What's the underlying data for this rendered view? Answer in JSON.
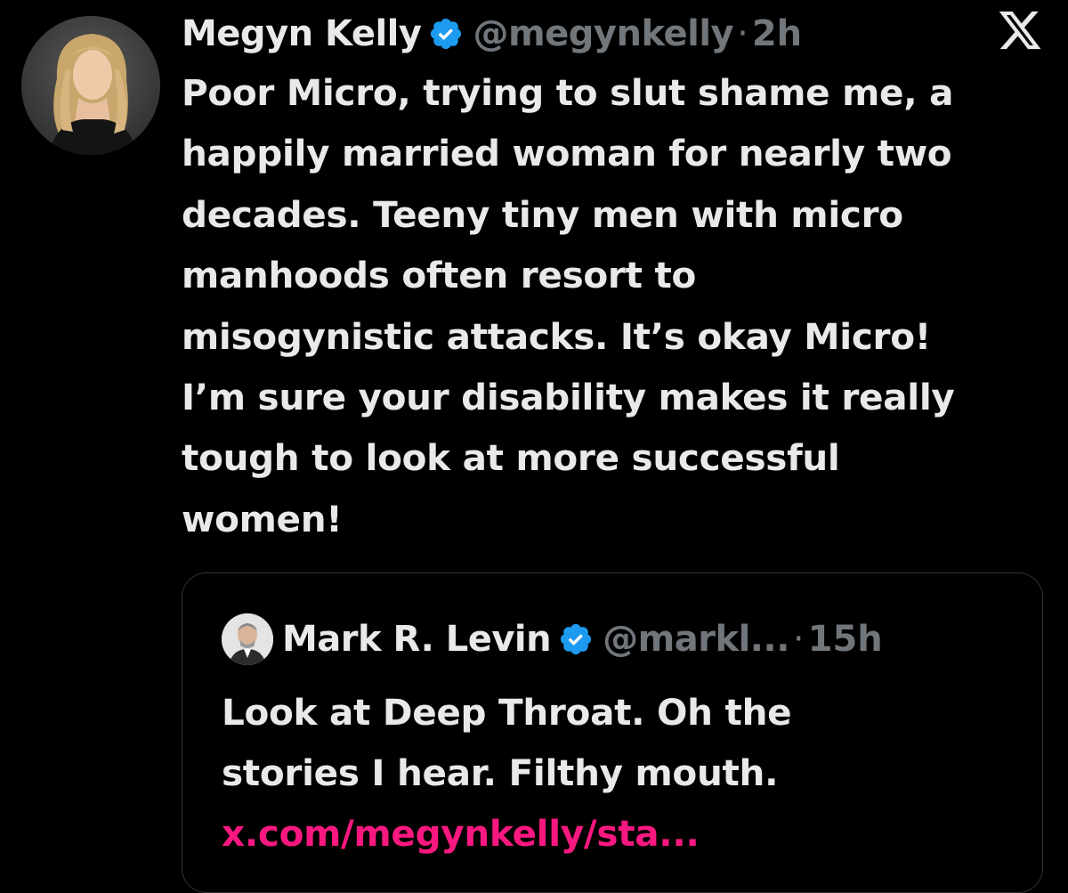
{
  "colors": {
    "background": "#000000",
    "text": "#e7e9ea",
    "muted": "#71767b",
    "verified": "#1d9bf0",
    "link": "#f91880",
    "border": "#2f3336"
  },
  "tweet": {
    "display_name": "Megyn Kelly",
    "handle": "@megynkelly",
    "separator": "·",
    "time": "2h",
    "verified_icon": "verified-badge-icon",
    "platform_icon": "x-logo-icon",
    "text_lines": [
      "Poor Micro, trying to slut shame me, a",
      "happily married woman for nearly two",
      "decades. Teeny tiny men with micro",
      "manhoods often resort to",
      "misogynistic attacks. It’s okay Micro!",
      "I’m sure your disability makes it really",
      "tough to look at more successful",
      "women!"
    ]
  },
  "quote": {
    "display_name": "Mark R. Levin",
    "handle": "@markl...",
    "separator": "·",
    "time": "15h",
    "verified_icon": "verified-badge-icon",
    "text_lines": [
      "Look at Deep Throat. Oh the",
      "stories I hear.  Filthy mouth."
    ],
    "link": "x.com/megynkelly/sta..."
  }
}
